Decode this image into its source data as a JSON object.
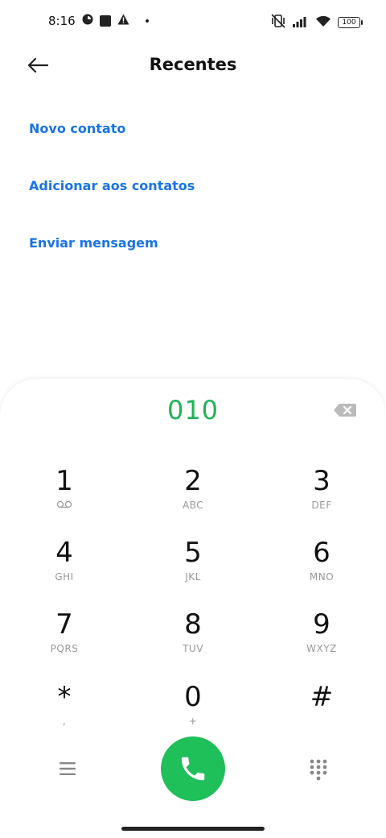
{
  "status_bar": {
    "time": "8:16",
    "battery": "100"
  },
  "header": {
    "title": "Recentes"
  },
  "actions": [
    {
      "label": "Novo contato"
    },
    {
      "label": "Adicionar aos contatos"
    },
    {
      "label": "Enviar mensagem"
    }
  ],
  "dialer": {
    "number": "010",
    "keys": [
      {
        "digit": "1",
        "letters": ""
      },
      {
        "digit": "2",
        "letters": "ABC"
      },
      {
        "digit": "3",
        "letters": "DEF"
      },
      {
        "digit": "4",
        "letters": "GHI"
      },
      {
        "digit": "5",
        "letters": "JKL"
      },
      {
        "digit": "6",
        "letters": "MNO"
      },
      {
        "digit": "7",
        "letters": "PQRS"
      },
      {
        "digit": "8",
        "letters": "TUV"
      },
      {
        "digit": "9",
        "letters": "WXYZ"
      },
      {
        "digit": "*",
        "letters": ","
      },
      {
        "digit": "0",
        "letters": "+"
      },
      {
        "digit": "#",
        "letters": ""
      }
    ]
  },
  "colors": {
    "accent_blue": "#1a73e8",
    "dial_green": "#1fbf5a",
    "number_green": "#1fb356"
  },
  "icons": {
    "back": "arrow-left-icon",
    "backspace": "backspace-icon",
    "voicemail": "voicemail-icon",
    "menu": "menu-icon",
    "call": "phone-icon",
    "keypad": "dialpad-icon"
  }
}
